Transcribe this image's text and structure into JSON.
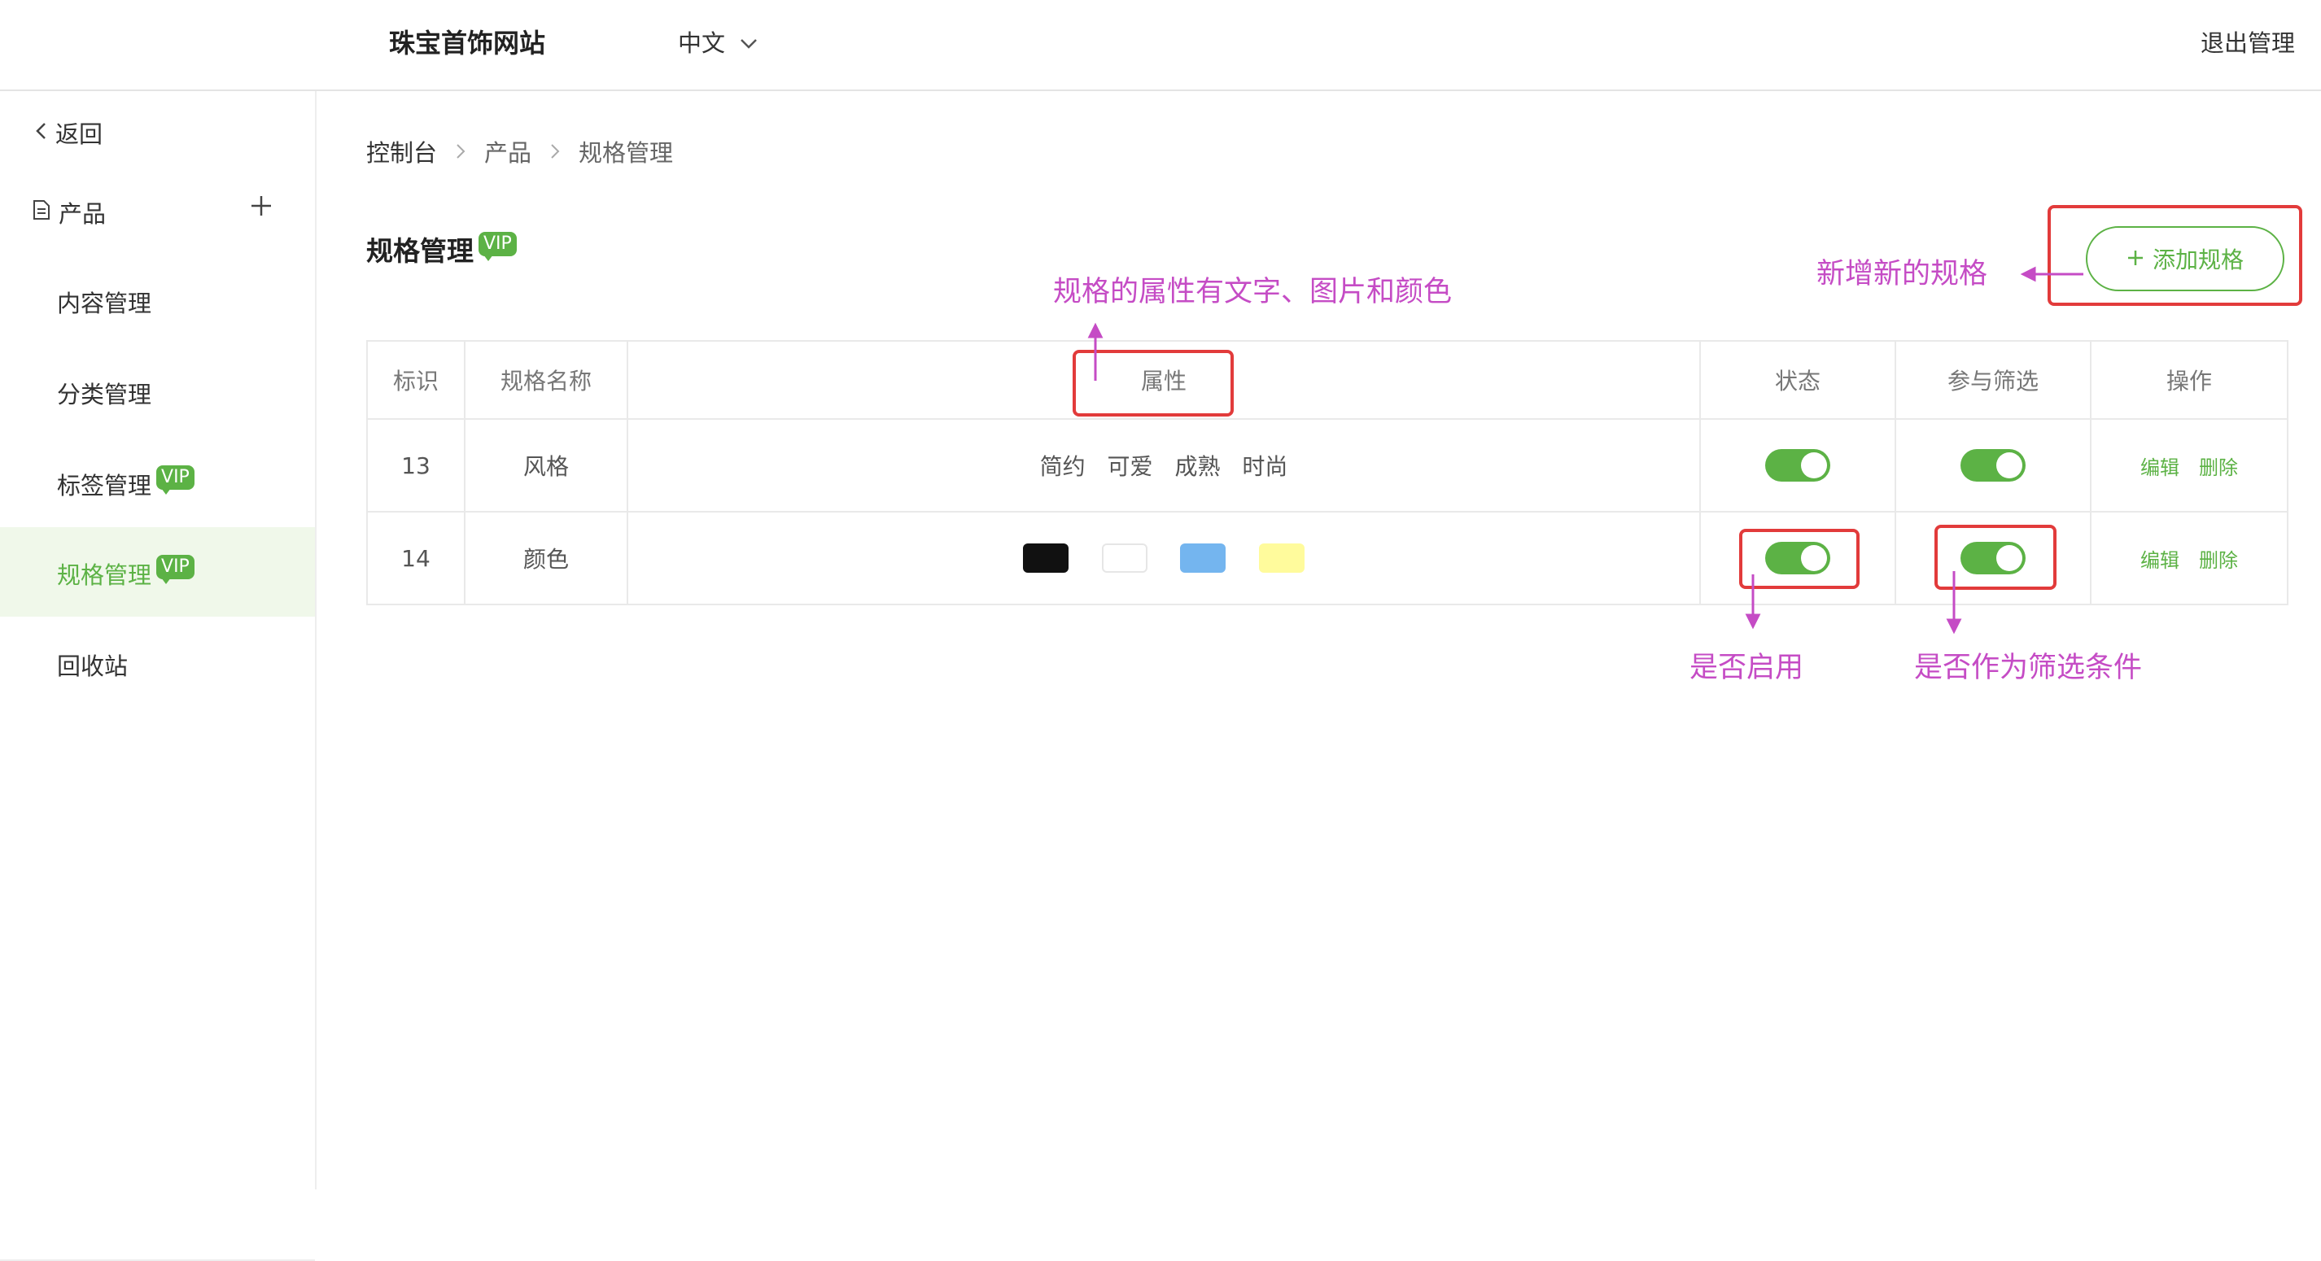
{
  "header": {
    "site_title": "珠宝首饰网站",
    "language": "中文",
    "logout": "退出管理"
  },
  "sidebar": {
    "back": "返回",
    "group": "产品",
    "items": [
      {
        "label": "内容管理",
        "vip": ""
      },
      {
        "label": "分类管理",
        "vip": ""
      },
      {
        "label": "标签管理",
        "vip": "VIP"
      },
      {
        "label": "规格管理",
        "vip": "VIP",
        "active": true
      },
      {
        "label": "回收站",
        "vip": ""
      }
    ]
  },
  "breadcrumb": [
    "控制台",
    "产品",
    "规格管理"
  ],
  "page": {
    "title": "规格管理",
    "vip": "VIP",
    "add_button": "添加规格"
  },
  "table": {
    "headers": [
      "标识",
      "规格名称",
      "属性",
      "状态",
      "参与筛选",
      "操作"
    ],
    "rows": [
      {
        "id": "13",
        "name": "风格",
        "attributes": [
          "简约",
          "可爱",
          "成熟",
          "时尚"
        ],
        "status_on": true,
        "filter_on": true,
        "edit": "编辑",
        "delete": "删除"
      },
      {
        "id": "14",
        "name": "颜色",
        "colors": [
          "#111111",
          "#ffffff",
          "#74b5ef",
          "#fffb9c"
        ],
        "status_on": true,
        "filter_on": true,
        "edit": "编辑",
        "delete": "删除"
      }
    ]
  },
  "annotations": {
    "attributes_note": "规格的属性有文字、图片和颜色",
    "add_note": "新增新的规格",
    "status_note": "是否启用",
    "filter_note": "是否作为筛选条件",
    "box_color": "#e23b3b",
    "text_color": "#c54cc5"
  },
  "colors": {
    "accent": "#5cb245",
    "active_bg": "#f0f8ea"
  }
}
